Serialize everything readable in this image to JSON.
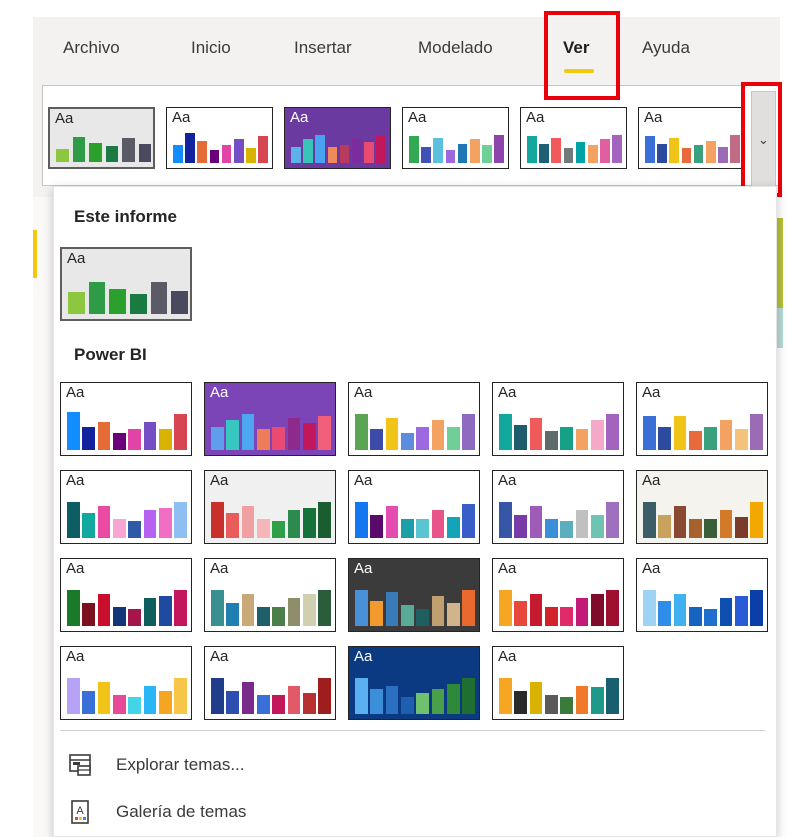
{
  "tabs": [
    {
      "label": "Archivo",
      "active": false
    },
    {
      "label": "Inicio",
      "active": false
    },
    {
      "label": "Insertar",
      "active": false
    },
    {
      "label": "Modelado",
      "active": false
    },
    {
      "label": "Ver",
      "active": true
    },
    {
      "label": "Ayuda",
      "active": false
    }
  ],
  "icons": {
    "expand": "chevron-down-icon",
    "explore": "browse-themes-icon",
    "gallery": "theme-gallery-icon"
  },
  "strip_themes": [
    {
      "name": "este-informe",
      "bg": "#e8e8e8",
      "text": "#252423",
      "colors": [
        "#8dc63f",
        "#2e9b47",
        "#2ca02c",
        "#1a7a42",
        "#5b5b68",
        "#4a4a5e"
      ],
      "heights": [
        0.45,
        0.85,
        0.65,
        0.55,
        0.8,
        0.6
      ]
    },
    {
      "name": "default",
      "bg": "#ffffff",
      "text": "#252423",
      "colors": [
        "#118dff",
        "#12239e",
        "#e66c37",
        "#6b007b",
        "#e044a7",
        "#744ec2",
        "#d9b300",
        "#d64550"
      ],
      "heights": [
        0.6,
        1,
        0.75,
        0.45,
        0.6,
        0.8,
        0.5,
        0.9
      ]
    },
    {
      "name": "innovate",
      "bg": "#6b3aa0",
      "text": "#ffffff",
      "colors": [
        "#5eb0e8",
        "#39c4b8",
        "#49a3f0",
        "#f08a5d",
        "#b83b5e",
        "#7b2d9e",
        "#e84a72",
        "#c2185b"
      ],
      "heights": [
        0.55,
        0.8,
        0.95,
        0.55,
        0.6,
        0.85,
        0.7,
        0.9
      ]
    },
    {
      "name": "bloom",
      "bg": "#ffffff",
      "text": "#252423",
      "colors": [
        "#34a853",
        "#3f51b5",
        "#5bc0de",
        "#9c6ade",
        "#1f77b4",
        "#f4a261",
        "#6fcf97",
        "#8e44ad"
      ],
      "heights": [
        0.9,
        0.55,
        0.85,
        0.45,
        0.65,
        0.8,
        0.6,
        0.95
      ]
    },
    {
      "name": "tidal",
      "bg": "#ffffff",
      "text": "#252423",
      "colors": [
        "#13a89e",
        "#1e5f74",
        "#f15a5a",
        "#6f7a7a",
        "#00a3a3",
        "#f4a261",
        "#e05fa0",
        "#a463bf"
      ],
      "heights": [
        0.9,
        0.65,
        0.85,
        0.5,
        0.7,
        0.6,
        0.8,
        0.95
      ]
    },
    {
      "name": "temperature",
      "bg": "#ffffff",
      "text": "#252423",
      "colors": [
        "#3a6fd8",
        "#2c4a9e",
        "#f0c419",
        "#e86a3c",
        "#3aa17e",
        "#f4a261",
        "#9b6bb5",
        "#c06c84"
      ],
      "heights": [
        0.9,
        0.65,
        0.85,
        0.5,
        0.6,
        0.75,
        0.55,
        0.95
      ]
    }
  ],
  "section_report": "Este informe",
  "report_themes": [
    {
      "name": "este-informe",
      "bg": "#e8e8e8",
      "text": "#252423",
      "colors": [
        "#8dc63f",
        "#2e9b47",
        "#2ca02c",
        "#1a7a42",
        "#5b5b68",
        "#4a4a5e"
      ],
      "heights": [
        0.6,
        0.9,
        0.7,
        0.55,
        0.9,
        0.65
      ]
    }
  ],
  "section_powerbi": "Power BI",
  "powerbi_themes": [
    {
      "name": "default",
      "bg": "#ffffff",
      "text": "#252423",
      "colors": [
        "#118dff",
        "#12239e",
        "#e66c37",
        "#6b007b",
        "#e044a7",
        "#744ec2",
        "#d9b300",
        "#d64550"
      ],
      "heights": [
        1,
        0.6,
        0.75,
        0.45,
        0.55,
        0.75,
        0.55,
        0.95
      ]
    },
    {
      "name": "innovate",
      "bg": "#7b45b8",
      "text": "#ffffff",
      "colors": [
        "#5e9eea",
        "#38c6c0",
        "#4ea6f2",
        "#f07b5a",
        "#e84a72",
        "#8e2a8c",
        "#c2185b",
        "#f25f7a"
      ],
      "heights": [
        0.6,
        0.8,
        0.95,
        0.55,
        0.6,
        0.85,
        0.7,
        0.9
      ]
    },
    {
      "name": "bloom",
      "bg": "#ffffff",
      "text": "#252423",
      "colors": [
        "#5aa454",
        "#3c4aa8",
        "#f0c419",
        "#5b8cde",
        "#9c6ade",
        "#f4a261",
        "#6fcf97",
        "#8e6bbf"
      ],
      "heights": [
        0.95,
        0.55,
        0.85,
        0.45,
        0.6,
        0.8,
        0.6,
        0.95
      ]
    },
    {
      "name": "tidal",
      "bg": "#ffffff",
      "text": "#252423",
      "colors": [
        "#13a89e",
        "#1f5c6b",
        "#f15a5a",
        "#5f6b6b",
        "#16a085",
        "#f4a261",
        "#f4a9c8",
        "#a463bf"
      ],
      "heights": [
        0.95,
        0.65,
        0.85,
        0.5,
        0.6,
        0.55,
        0.8,
        0.95
      ]
    },
    {
      "name": "temperature",
      "bg": "#ffffff",
      "text": "#252423",
      "colors": [
        "#3a6fd8",
        "#2c4a9e",
        "#f0c419",
        "#e86a3c",
        "#3aa17e",
        "#f4a261",
        "#f4c27a",
        "#9b6bb5"
      ],
      "heights": [
        0.9,
        0.6,
        0.9,
        0.5,
        0.6,
        0.8,
        0.55,
        0.95
      ]
    },
    {
      "name": "electric",
      "bg": "#ffffff",
      "text": "#252423",
      "colors": [
        "#0c5e63",
        "#11a8a0",
        "#e94ba3",
        "#f8a5d4",
        "#2f5aa8",
        "#b562f0",
        "#f06fc4",
        "#8fbff2"
      ],
      "heights": [
        0.95,
        0.65,
        0.85,
        0.5,
        0.45,
        0.75,
        0.8,
        0.95
      ]
    },
    {
      "name": "executive",
      "bg": "#f0f0f0",
      "text": "#252423",
      "colors": [
        "#c9302c",
        "#e85c5c",
        "#f0a0a0",
        "#f4b6b6",
        "#2ea04a",
        "#2d8a4e",
        "#14723a",
        "#1a5e30"
      ],
      "heights": [
        0.95,
        0.65,
        0.85,
        0.5,
        0.45,
        0.75,
        0.8,
        0.95
      ]
    },
    {
      "name": "frontier",
      "bg": "#ffffff",
      "text": "#252423",
      "colors": [
        "#1576f2",
        "#5a0a6b",
        "#e34cb0",
        "#1c9fa8",
        "#5ac5d0",
        "#e8548a",
        "#13a4b8",
        "#3a5ec8"
      ],
      "heights": [
        0.95,
        0.6,
        0.85,
        0.5,
        0.5,
        0.75,
        0.55,
        0.9
      ]
    },
    {
      "name": "highrise",
      "bg": "#ffffff",
      "text": "#252423",
      "colors": [
        "#3856a8",
        "#7a3ba8",
        "#9e5bb8",
        "#3a8fd8",
        "#5aaec0",
        "#c0c0c0",
        "#6fc3b1",
        "#a070c0"
      ],
      "heights": [
        0.95,
        0.6,
        0.85,
        0.5,
        0.45,
        0.75,
        0.6,
        0.95
      ]
    },
    {
      "name": "sunset",
      "bg": "#f5f3ee",
      "text": "#252423",
      "colors": [
        "#3d5d66",
        "#c9a35d",
        "#8a4a32",
        "#a6622c",
        "#3a5e3a",
        "#d27a2a",
        "#7a3b2a",
        "#f2a800"
      ],
      "heights": [
        0.95,
        0.6,
        0.85,
        0.5,
        0.5,
        0.75,
        0.55,
        0.95
      ]
    },
    {
      "name": "twilight",
      "bg": "#ffffff",
      "text": "#252423",
      "colors": [
        "#1a7a2a",
        "#7b1020",
        "#c8102e",
        "#15357a",
        "#a4154a",
        "#0e5e5e",
        "#1f4aa0",
        "#c2185b"
      ],
      "heights": [
        0.95,
        0.6,
        0.85,
        0.5,
        0.45,
        0.75,
        0.8,
        0.95
      ]
    },
    {
      "name": "accessible-city-park",
      "bg": "#ffffff",
      "text": "#252423",
      "colors": [
        "#3a9090",
        "#1f7fb0",
        "#c9a87a",
        "#1e5f6a",
        "#4a7f4a",
        "#8e8e6a",
        "#d0d0b0",
        "#2a5e3a"
      ],
      "heights": [
        0.95,
        0.6,
        0.85,
        0.5,
        0.5,
        0.75,
        0.85,
        0.95
      ]
    },
    {
      "name": "city-park-dark",
      "bg": "#3b3b3b",
      "text": "#ffffff",
      "colors": [
        "#4a90d9",
        "#f29a2e",
        "#3a7ab8",
        "#5aaa9a",
        "#1f5f5f",
        "#c0a070",
        "#d2b48c",
        "#e86a2e"
      ],
      "heights": [
        0.95,
        0.65,
        0.9,
        0.55,
        0.45,
        0.8,
        0.6,
        0.95
      ]
    },
    {
      "name": "classroom",
      "bg": "#ffffff",
      "text": "#252423",
      "colors": [
        "#f5a623",
        "#e8483c",
        "#c61a2e",
        "#d2232a",
        "#e02a6a",
        "#c31a7a",
        "#800a2a",
        "#9e1030"
      ],
      "heights": [
        0.95,
        0.65,
        0.85,
        0.5,
        0.5,
        0.75,
        0.85,
        0.95
      ]
    },
    {
      "name": "colorblind-safe",
      "bg": "#ffffff",
      "text": "#252423",
      "colors": [
        "#9fd3f5",
        "#2e8de8",
        "#40b0f0",
        "#1565c0",
        "#1f6fd0",
        "#0f4fb0",
        "#2a5bd7",
        "#0a3ea8"
      ],
      "heights": [
        0.95,
        0.65,
        0.85,
        0.5,
        0.45,
        0.75,
        0.8,
        0.95
      ]
    },
    {
      "name": "electric-2",
      "bg": "#ffffff",
      "text": "#252423",
      "colors": [
        "#b8a2f5",
        "#3a6fd8",
        "#f0c419",
        "#e84a9a",
        "#44d4e8",
        "#29b6f6",
        "#f4a623",
        "#f7c648"
      ],
      "heights": [
        0.95,
        0.6,
        0.85,
        0.5,
        0.45,
        0.75,
        0.6,
        0.95
      ]
    },
    {
      "name": "high-contrast",
      "bg": "#ffffff",
      "text": "#252423",
      "colors": [
        "#1f3d8a",
        "#2e4fb0",
        "#7a2a8a",
        "#3a6fd8",
        "#c2185b",
        "#e05a6a",
        "#b83030",
        "#9e1e1e"
      ],
      "heights": [
        0.95,
        0.6,
        0.85,
        0.5,
        0.5,
        0.75,
        0.55,
        0.95
      ]
    },
    {
      "name": "solar",
      "bg": "#0b3a82",
      "text": "#ffffff",
      "colors": [
        "#5ab0f0",
        "#3a8fd8",
        "#2a6fc0",
        "#1f5fb0",
        "#6fc06f",
        "#4aa04a",
        "#2e8a3a",
        "#1f7030"
      ],
      "heights": [
        0.95,
        0.65,
        0.75,
        0.45,
        0.55,
        0.65,
        0.8,
        0.95
      ]
    },
    {
      "name": "storm",
      "bg": "#ffffff",
      "text": "#252423",
      "colors": [
        "#f5a623",
        "#2a2a2a",
        "#d9b300",
        "#5a5a5a",
        "#3a7a3a",
        "#f07a2a",
        "#1f9a8a",
        "#1a5f6f"
      ],
      "heights": [
        0.95,
        0.6,
        0.85,
        0.5,
        0.45,
        0.75,
        0.7,
        0.95
      ]
    }
  ],
  "thumb_label": "Aa",
  "menu": {
    "explore": "Explorar temas...",
    "gallery": "Galería de temas"
  }
}
